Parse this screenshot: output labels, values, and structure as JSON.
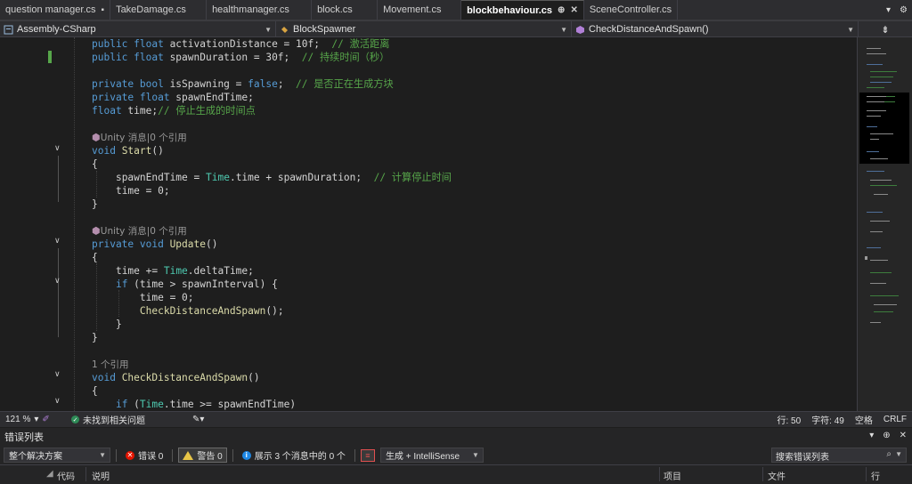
{
  "tabs": [
    {
      "label": "question manager.cs",
      "pin": "▪",
      "active": false
    },
    {
      "label": "TakeDamage.cs",
      "active": false
    },
    {
      "label": "healthmanager.cs",
      "active": false
    },
    {
      "label": "block.cs",
      "active": false
    },
    {
      "label": "Movement.cs",
      "active": false
    },
    {
      "label": "blockbehaviour.cs",
      "pin": "⊕",
      "close": "✕",
      "active": true
    },
    {
      "label": "SceneController.cs",
      "active": false
    }
  ],
  "tabbar_right": {
    "dropdown": "▾",
    "settings": "⚙"
  },
  "nav": {
    "project": "Assembly-CSharp",
    "class": "BlockSpawner",
    "member": "CheckDistanceAndSpawn()",
    "split_icon": "⇟"
  },
  "code_lines": {
    "l1_kw": "public float ",
    "l1_rest": "activationDistance = 10f;  ",
    "l1_cm": "// 激活距离",
    "l2_kw": "public float ",
    "l2_rest": "spawnDuration = 30f;  ",
    "l2_cm": "// 持续时间（秒）",
    "l4_kw": "private bool ",
    "l4_rest": "isSpawning = ",
    "l4_kw2": "false",
    "l4_rest2": ";  ",
    "l4_cm": "// 是否正在生成方块",
    "l5_kw": "private float ",
    "l5_rest": "spawnEndTime;",
    "l6_kw": "float ",
    "l6_rest": "time;",
    "l6_cm": "// 停止生成的时间点",
    "lens1": "Unity 消息|0 个引用",
    "l8_kw": "void ",
    "l8_fn": "Start",
    "l8_rest": "()",
    "l9": "{",
    "l10_a": "spawnEndTime = ",
    "l10_ty": "Time",
    "l10_b": ".time + spawnDuration;  ",
    "l10_cm": "// 计算停止时间",
    "l11": "time = 0;",
    "l12": "}",
    "lens2": "Unity 消息|0 个引用",
    "l15_kw": "private void ",
    "l15_fn": "Update",
    "l15_rest": "()",
    "l16": "{",
    "l17_a": "time += ",
    "l17_ty": "Time",
    "l17_b": ".deltaTime;",
    "l18_kw": "if ",
    "l18_rest": "(time > spawnInterval) {",
    "l19": "time = 0;",
    "l20_fn": "CheckDistanceAndSpawn",
    "l20_rest": "();",
    "l21": "}",
    "l22": "}",
    "lens3": "1 个引用",
    "l25_kw": "void ",
    "l25_fn": "CheckDistanceAndSpawn",
    "l25_rest": "()",
    "l26": "{",
    "l27_kw": "if ",
    "l27_a": "(",
    "l27_ty": "Time",
    "l27_b": ".time >= spawnEndTime)"
  },
  "status": {
    "zoom": "121 %",
    "issues": "未找到相关问题",
    "line": "行: 50",
    "char": "字符: 49",
    "spacing": "空格",
    "eol": "CRLF"
  },
  "error_list": {
    "title": "错误列表",
    "scope": "整个解决方案",
    "errors": "错误 0",
    "warnings": "警告 0",
    "messages": "展示 3 个消息中的 0 个",
    "build_filter": "生成 + IntelliSense",
    "search_placeholder": "搜索错误列表",
    "columns": {
      "code": "代码",
      "description": "说明",
      "project": "项目",
      "file": "文件",
      "line": "行"
    }
  },
  "colors": {
    "keyword": "#569cd6",
    "type": "#4ec9b0",
    "method": "#dcdcaa",
    "comment": "#57a64a",
    "text": "#d4d4d4"
  }
}
